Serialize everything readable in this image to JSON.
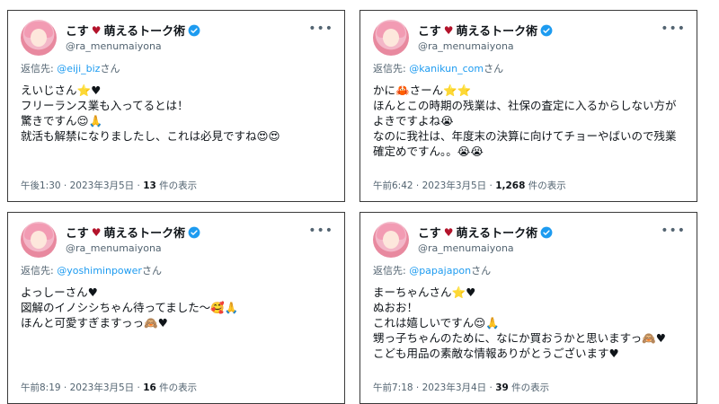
{
  "account": {
    "display_name": "こす",
    "display_name_suffix": "萌えるトーク術",
    "handle": "@ra_menumaiyona"
  },
  "reply_prefix": "返信先: ",
  "san_suffix": "さん",
  "views_suffix": " 件の表示",
  "icons": {
    "heart": "red-heart",
    "verified": "blue-verified-badge",
    "more": "three-dots"
  },
  "tweets": [
    {
      "reply_to": "@eiji_biz",
      "lines": [
        "えいじさん⭐♥",
        "フリーランス業も入ってるとは！",
        "驚きですん😌🙏",
        "就活も解禁になりましたし、これは必見ですね😍😍"
      ],
      "time": "午後1:30 · 2023年3月5日 · ",
      "views": "13"
    },
    {
      "reply_to": "@kanikun_com",
      "lines": [
        "かに🦀さーん⭐⭐",
        "ほんとこの時期の残業は、社保の査定に入るからしない方がよきですよね😭",
        "なのに我社は、年度末の決算に向けてチョーやばいので残業確定めですん。。😭😭"
      ],
      "time": "午前6:42 · 2023年3月5日 · ",
      "views": "1,268"
    },
    {
      "reply_to": "@yoshiminpower",
      "lines": [
        "よっしーさん♥",
        "図解のイノシシちゃん待ってました〜🥰🙏",
        "ほんと可愛すぎますっっ🙈♥"
      ],
      "time": "午前8:19 · 2023年3月5日 · ",
      "views": "16"
    },
    {
      "reply_to": "@papajapon",
      "lines": [
        "まーちゃんさん⭐♥",
        "ぬおお！",
        "これは嬉しいですん😌🙏",
        "甥っ子ちゃんのために、なにか買おうかと思いますっ🙈♥",
        "こども用品の素敵な情報ありがとうございます♥"
      ],
      "time": "午前7:18 · 2023年3月4日 · ",
      "views": "39"
    }
  ]
}
